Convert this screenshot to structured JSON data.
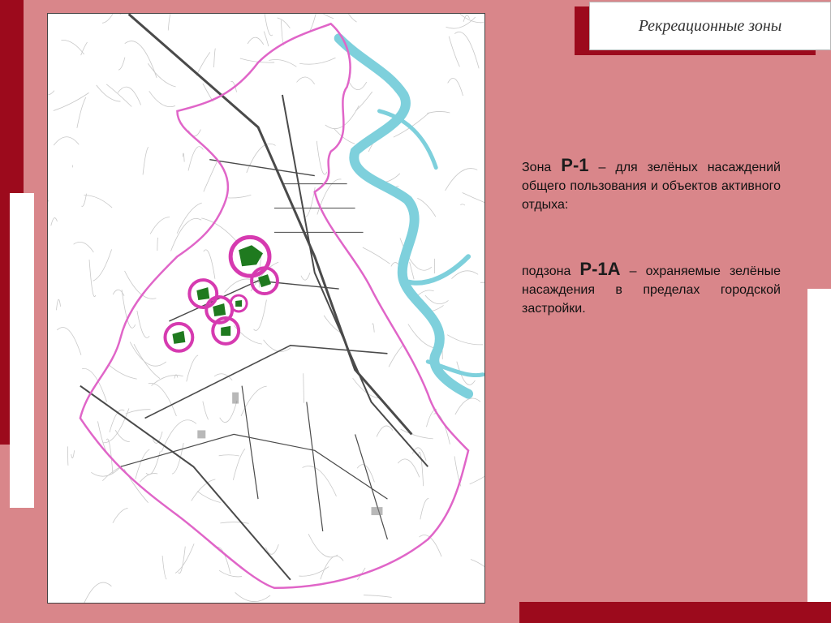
{
  "slide": {
    "title": "Рекреационные зоны",
    "colors": {
      "background": "#d9868a",
      "accent_dark_red": "#9c0a1c",
      "zone_boundary": "#e065c8",
      "zone_fill": "#1f7a1f",
      "zone_circle": "#d63ab0",
      "river": "#7ed0dc"
    }
  },
  "map": {
    "description_icon": "city-map",
    "recreation_zones_marked": 7
  },
  "legend": [
    {
      "prefix": "Зона",
      "code": "Р-1",
      "dash": "–",
      "text": "для зелёных насаждений общего пользования и объектов активного отдыха:"
    },
    {
      "prefix": "подзона",
      "code": "Р-1А",
      "dash": "–",
      "text": "охраняемые зелёные насаждения в пределах городской застройки."
    }
  ]
}
